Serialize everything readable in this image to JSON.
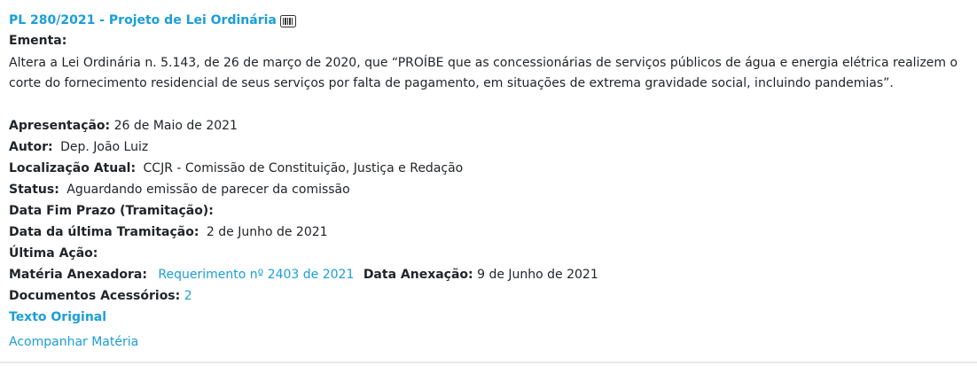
{
  "title": "PL 280/2021 - Projeto de Lei Ordinária",
  "ementa": {
    "label": "Ementa:",
    "text": "Altera a Lei Ordinária n. 5.143, de 26 de março de 2020, que “PROÍBE que as concessionárias de serviços públicos de água e energia elétrica realizem o corte do fornecimento residencial de seus serviços por falta de pagamento, em situações de extrema gravidade social, incluindo pandemias”."
  },
  "fields": {
    "apresentacao_label": "Apresentação:",
    "apresentacao_value": "26 de Maio de 2021",
    "autor_label": "Autor:",
    "autor_value": "Dep. João Luiz",
    "localizacao_label": "Localização Atual:",
    "localizacao_value": "CCJR - Comissão de Constituição, Justiça e Redação",
    "status_label": "Status:",
    "status_value": "Aguardando emissão de parecer da comissão",
    "data_fim_prazo_label": "Data Fim Prazo (Tramitação):",
    "data_ultima_tramitacao_label": "Data da última Tramitação:",
    "data_ultima_tramitacao_value": "2 de Junho de 2021",
    "ultima_acao_label": "Última Ação:",
    "materia_anexadora_label": "Matéria Anexadora:",
    "materia_anexadora_value": "Requerimento nº 2403 de 2021",
    "data_anexacao_label": "Data Anexação:",
    "data_anexacao_value": "9 de Junho de 2021",
    "documentos_label": "Documentos Acessórios:",
    "documentos_value": "2"
  },
  "links": {
    "texto_original": "Texto Original",
    "acompanhar": "Acompanhar Matéria"
  },
  "colors": {
    "link": "#1a9ed8",
    "text": "#212529"
  },
  "icons": {
    "title_icon": "barcode-icon"
  }
}
